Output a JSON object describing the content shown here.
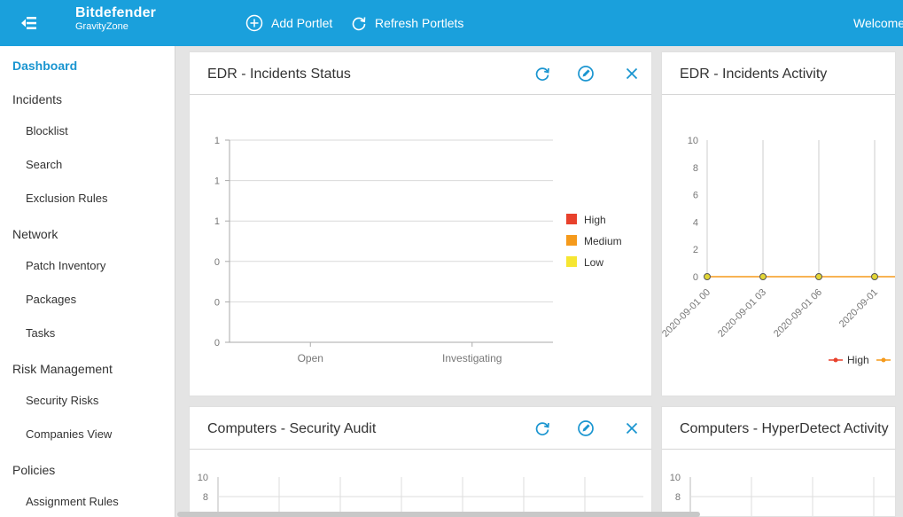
{
  "topbar": {
    "brand_name": "Bitdefender",
    "brand_product": "GravityZone",
    "add_portlet_label": "Add Portlet",
    "refresh_portlets_label": "Refresh Portlets",
    "welcome_text": "Welcome,"
  },
  "sidebar": {
    "dashboard": "Dashboard",
    "incidents": "Incidents",
    "blocklist": "Blocklist",
    "search": "Search",
    "exclusion_rules": "Exclusion Rules",
    "network": "Network",
    "patch_inventory": "Patch Inventory",
    "packages": "Packages",
    "tasks": "Tasks",
    "risk_management": "Risk Management",
    "security_risks": "Security Risks",
    "companies_view": "Companies View",
    "policies": "Policies",
    "assignment_rules": "Assignment Rules"
  },
  "portlets": {
    "edr_status_title": "EDR - Incidents Status",
    "edr_activity_title": "EDR - Incidents Activity",
    "security_audit_title": "Computers - Security Audit",
    "hyperdetect_title": "Computers - HyperDetect Activity"
  },
  "colors": {
    "accent": "#1aa0dc",
    "high": "#e8412c",
    "medium": "#f59a1b",
    "low": "#f6e632",
    "line_marker": "#e2d635"
  },
  "chart_data": [
    {
      "type": "bar",
      "categories": [
        "Open",
        "Investigating"
      ],
      "series": [
        {
          "name": "High",
          "values": [
            0,
            0
          ]
        },
        {
          "name": "Medium",
          "values": [
            0,
            0
          ]
        },
        {
          "name": "Low",
          "values": [
            0,
            0
          ]
        }
      ],
      "ytick_labels": [
        "1",
        "1",
        "1",
        "0",
        "0",
        "0"
      ],
      "legend": "right",
      "grid": true
    },
    {
      "type": "line",
      "x": [
        "2020-09-01 00",
        "2020-09-01 03",
        "2020-09-01 06",
        "2020-09-01"
      ],
      "series": [
        {
          "name": "High",
          "values": [
            0,
            0,
            0,
            0
          ]
        }
      ],
      "yticks": [
        0,
        2,
        4,
        6,
        8,
        10
      ],
      "ylim": [
        0,
        10
      ],
      "legend": "bottom",
      "grid": true
    },
    {
      "type": "bar",
      "yticks": [
        8,
        10
      ],
      "grid": true
    },
    {
      "type": "bar",
      "yticks": [
        8,
        10
      ],
      "grid": true
    }
  ]
}
